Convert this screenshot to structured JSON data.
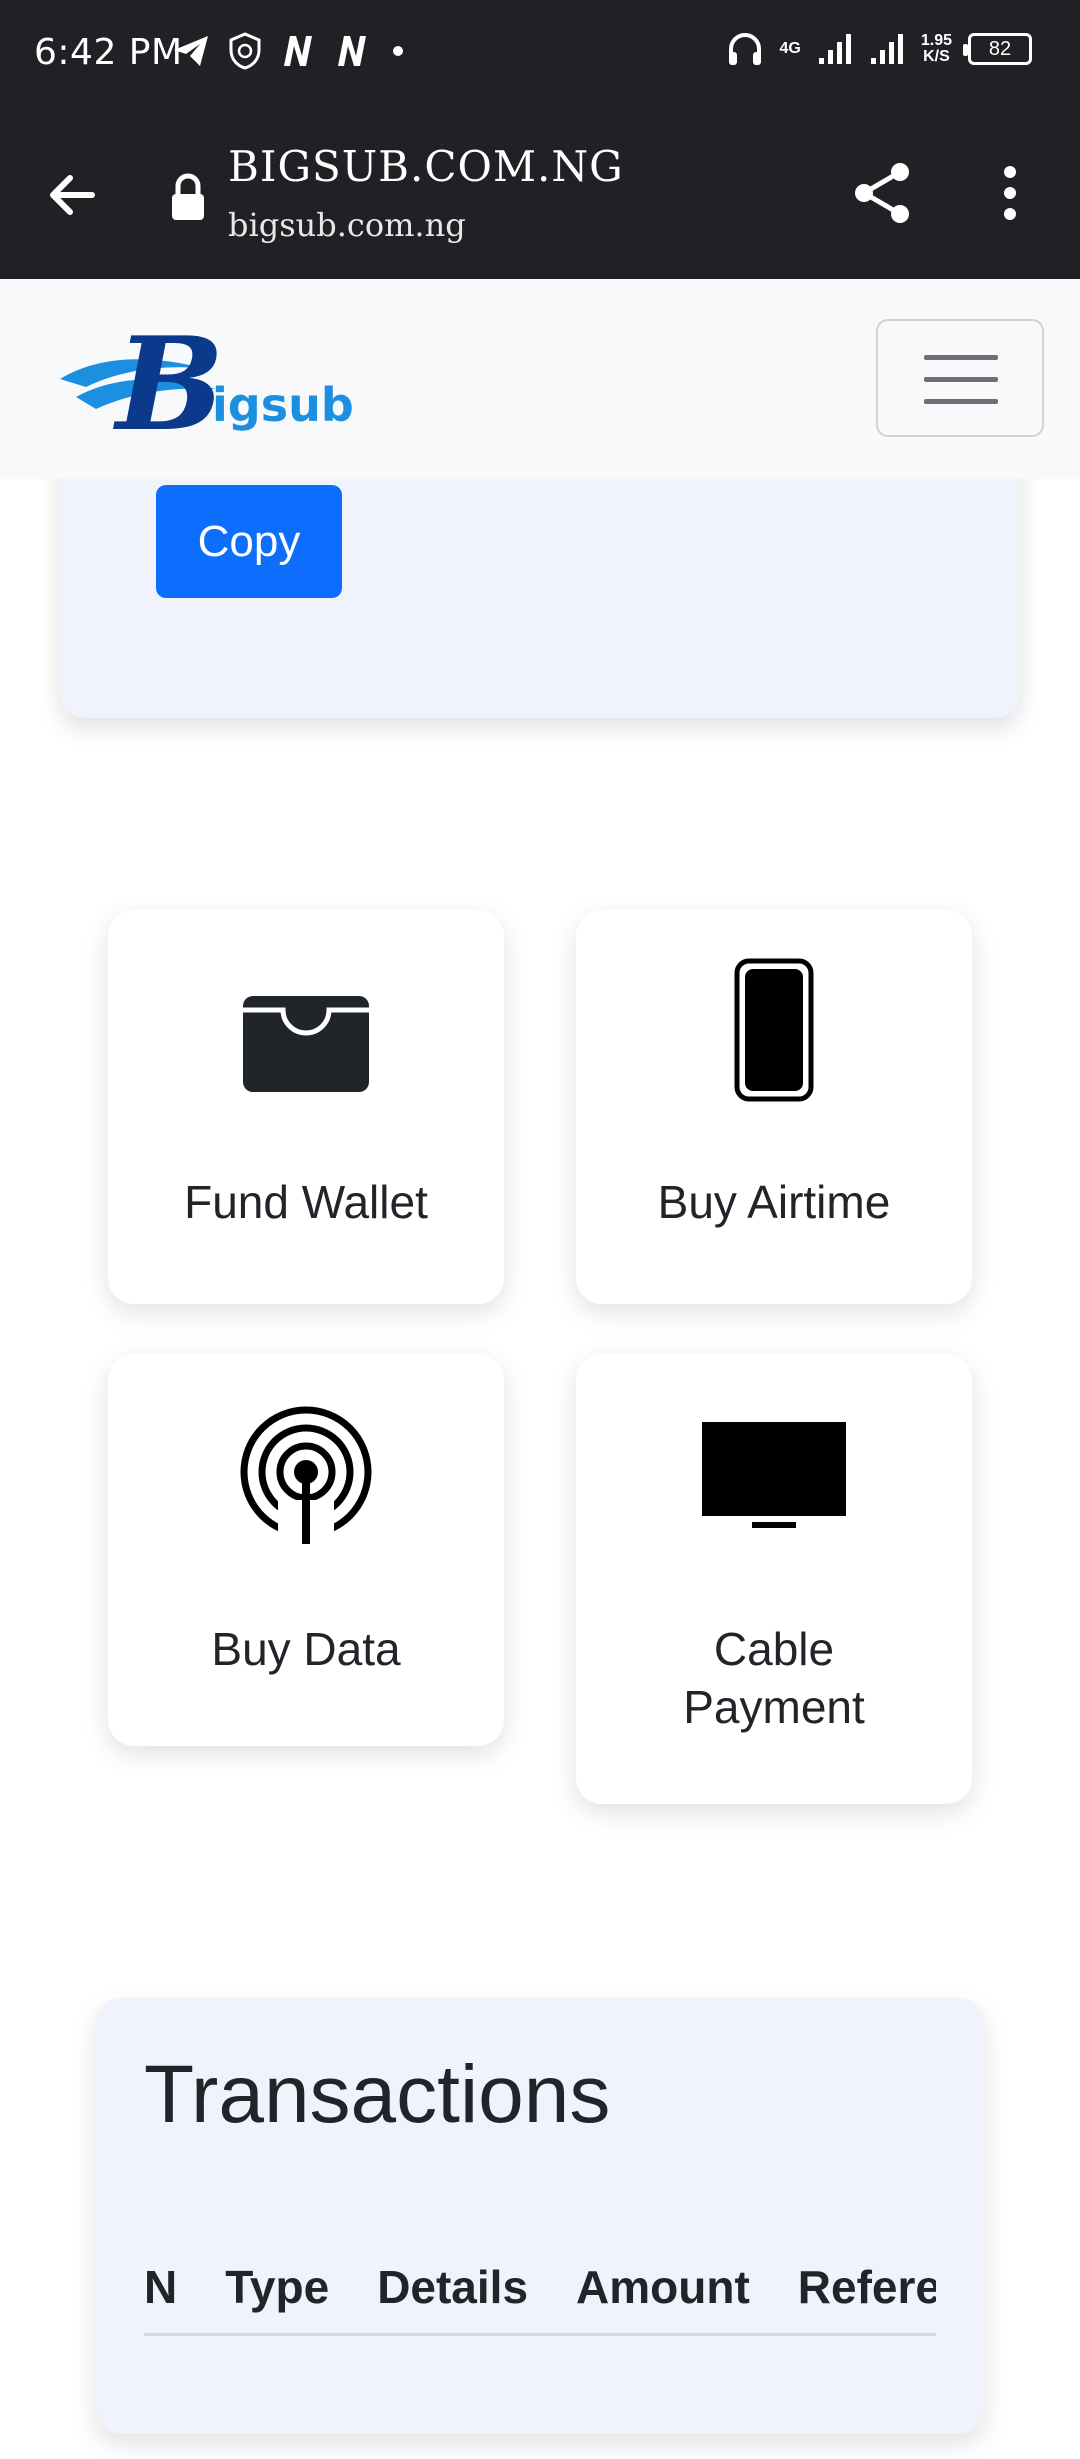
{
  "status_bar": {
    "time": "6:42 PM",
    "network_type": "4G",
    "speed_value": "1.95",
    "speed_unit": "K/S",
    "battery": "82",
    "icons": [
      "telegram-icon",
      "shield-icon",
      "netflix-n-icon",
      "netflix-n-icon",
      "dot-icon",
      "headphones-icon",
      "signal-icon",
      "signal-icon"
    ]
  },
  "browser": {
    "site_title": "BIGSUB.COM.NG",
    "site_url": "bigsub.com.ng",
    "icons": [
      "back-arrow-icon",
      "lock-icon",
      "share-icon",
      "more-vert-icon"
    ]
  },
  "navbar": {
    "logo_text": "Bigsub",
    "logo_letter": "B",
    "logo_rest": "igsub",
    "colors": {
      "logo_dark": "#0b3a8c",
      "logo_light": "#1d8fe0"
    }
  },
  "account_card": {
    "copy_label": "Copy",
    "colors": {
      "button": "#0d6efd"
    }
  },
  "actions": [
    {
      "label": "Fund Wallet",
      "icon": "wallet-icon"
    },
    {
      "label": "Buy Airtime",
      "icon": "phone-icon"
    },
    {
      "label": "Buy Data",
      "icon": "broadcast-icon"
    },
    {
      "label": "Cable Payment",
      "icon": "tv-icon"
    }
  ],
  "transactions": {
    "title": "Transactions",
    "columns": [
      "N",
      "Type",
      "Details",
      "Amount",
      "Refere"
    ]
  }
}
